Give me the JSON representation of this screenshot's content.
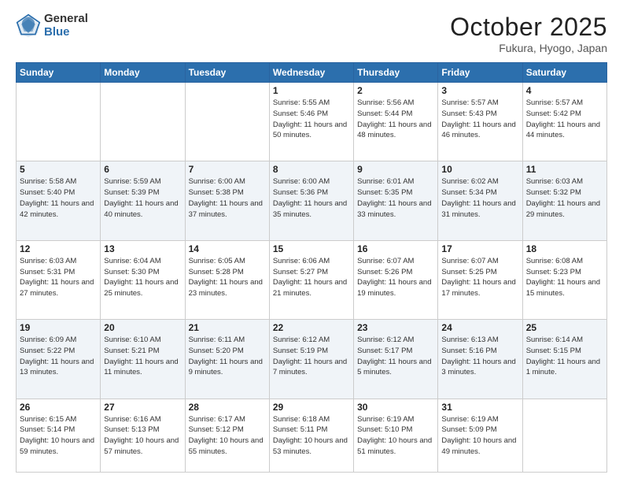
{
  "logo": {
    "general": "General",
    "blue": "Blue"
  },
  "header": {
    "month": "October 2025",
    "location": "Fukura, Hyogo, Japan"
  },
  "weekdays": [
    "Sunday",
    "Monday",
    "Tuesday",
    "Wednesday",
    "Thursday",
    "Friday",
    "Saturday"
  ],
  "weeks": [
    [
      {
        "day": "",
        "sunrise": "",
        "sunset": "",
        "daylight": ""
      },
      {
        "day": "",
        "sunrise": "",
        "sunset": "",
        "daylight": ""
      },
      {
        "day": "",
        "sunrise": "",
        "sunset": "",
        "daylight": ""
      },
      {
        "day": "1",
        "sunrise": "Sunrise: 5:55 AM",
        "sunset": "Sunset: 5:46 PM",
        "daylight": "Daylight: 11 hours and 50 minutes."
      },
      {
        "day": "2",
        "sunrise": "Sunrise: 5:56 AM",
        "sunset": "Sunset: 5:44 PM",
        "daylight": "Daylight: 11 hours and 48 minutes."
      },
      {
        "day": "3",
        "sunrise": "Sunrise: 5:57 AM",
        "sunset": "Sunset: 5:43 PM",
        "daylight": "Daylight: 11 hours and 46 minutes."
      },
      {
        "day": "4",
        "sunrise": "Sunrise: 5:57 AM",
        "sunset": "Sunset: 5:42 PM",
        "daylight": "Daylight: 11 hours and 44 minutes."
      }
    ],
    [
      {
        "day": "5",
        "sunrise": "Sunrise: 5:58 AM",
        "sunset": "Sunset: 5:40 PM",
        "daylight": "Daylight: 11 hours and 42 minutes."
      },
      {
        "day": "6",
        "sunrise": "Sunrise: 5:59 AM",
        "sunset": "Sunset: 5:39 PM",
        "daylight": "Daylight: 11 hours and 40 minutes."
      },
      {
        "day": "7",
        "sunrise": "Sunrise: 6:00 AM",
        "sunset": "Sunset: 5:38 PM",
        "daylight": "Daylight: 11 hours and 37 minutes."
      },
      {
        "day": "8",
        "sunrise": "Sunrise: 6:00 AM",
        "sunset": "Sunset: 5:36 PM",
        "daylight": "Daylight: 11 hours and 35 minutes."
      },
      {
        "day": "9",
        "sunrise": "Sunrise: 6:01 AM",
        "sunset": "Sunset: 5:35 PM",
        "daylight": "Daylight: 11 hours and 33 minutes."
      },
      {
        "day": "10",
        "sunrise": "Sunrise: 6:02 AM",
        "sunset": "Sunset: 5:34 PM",
        "daylight": "Daylight: 11 hours and 31 minutes."
      },
      {
        "day": "11",
        "sunrise": "Sunrise: 6:03 AM",
        "sunset": "Sunset: 5:32 PM",
        "daylight": "Daylight: 11 hours and 29 minutes."
      }
    ],
    [
      {
        "day": "12",
        "sunrise": "Sunrise: 6:03 AM",
        "sunset": "Sunset: 5:31 PM",
        "daylight": "Daylight: 11 hours and 27 minutes."
      },
      {
        "day": "13",
        "sunrise": "Sunrise: 6:04 AM",
        "sunset": "Sunset: 5:30 PM",
        "daylight": "Daylight: 11 hours and 25 minutes."
      },
      {
        "day": "14",
        "sunrise": "Sunrise: 6:05 AM",
        "sunset": "Sunset: 5:28 PM",
        "daylight": "Daylight: 11 hours and 23 minutes."
      },
      {
        "day": "15",
        "sunrise": "Sunrise: 6:06 AM",
        "sunset": "Sunset: 5:27 PM",
        "daylight": "Daylight: 11 hours and 21 minutes."
      },
      {
        "day": "16",
        "sunrise": "Sunrise: 6:07 AM",
        "sunset": "Sunset: 5:26 PM",
        "daylight": "Daylight: 11 hours and 19 minutes."
      },
      {
        "day": "17",
        "sunrise": "Sunrise: 6:07 AM",
        "sunset": "Sunset: 5:25 PM",
        "daylight": "Daylight: 11 hours and 17 minutes."
      },
      {
        "day": "18",
        "sunrise": "Sunrise: 6:08 AM",
        "sunset": "Sunset: 5:23 PM",
        "daylight": "Daylight: 11 hours and 15 minutes."
      }
    ],
    [
      {
        "day": "19",
        "sunrise": "Sunrise: 6:09 AM",
        "sunset": "Sunset: 5:22 PM",
        "daylight": "Daylight: 11 hours and 13 minutes."
      },
      {
        "day": "20",
        "sunrise": "Sunrise: 6:10 AM",
        "sunset": "Sunset: 5:21 PM",
        "daylight": "Daylight: 11 hours and 11 minutes."
      },
      {
        "day": "21",
        "sunrise": "Sunrise: 6:11 AM",
        "sunset": "Sunset: 5:20 PM",
        "daylight": "Daylight: 11 hours and 9 minutes."
      },
      {
        "day": "22",
        "sunrise": "Sunrise: 6:12 AM",
        "sunset": "Sunset: 5:19 PM",
        "daylight": "Daylight: 11 hours and 7 minutes."
      },
      {
        "day": "23",
        "sunrise": "Sunrise: 6:12 AM",
        "sunset": "Sunset: 5:17 PM",
        "daylight": "Daylight: 11 hours and 5 minutes."
      },
      {
        "day": "24",
        "sunrise": "Sunrise: 6:13 AM",
        "sunset": "Sunset: 5:16 PM",
        "daylight": "Daylight: 11 hours and 3 minutes."
      },
      {
        "day": "25",
        "sunrise": "Sunrise: 6:14 AM",
        "sunset": "Sunset: 5:15 PM",
        "daylight": "Daylight: 11 hours and 1 minute."
      }
    ],
    [
      {
        "day": "26",
        "sunrise": "Sunrise: 6:15 AM",
        "sunset": "Sunset: 5:14 PM",
        "daylight": "Daylight: 10 hours and 59 minutes."
      },
      {
        "day": "27",
        "sunrise": "Sunrise: 6:16 AM",
        "sunset": "Sunset: 5:13 PM",
        "daylight": "Daylight: 10 hours and 57 minutes."
      },
      {
        "day": "28",
        "sunrise": "Sunrise: 6:17 AM",
        "sunset": "Sunset: 5:12 PM",
        "daylight": "Daylight: 10 hours and 55 minutes."
      },
      {
        "day": "29",
        "sunrise": "Sunrise: 6:18 AM",
        "sunset": "Sunset: 5:11 PM",
        "daylight": "Daylight: 10 hours and 53 minutes."
      },
      {
        "day": "30",
        "sunrise": "Sunrise: 6:19 AM",
        "sunset": "Sunset: 5:10 PM",
        "daylight": "Daylight: 10 hours and 51 minutes."
      },
      {
        "day": "31",
        "sunrise": "Sunrise: 6:19 AM",
        "sunset": "Sunset: 5:09 PM",
        "daylight": "Daylight: 10 hours and 49 minutes."
      },
      {
        "day": "",
        "sunrise": "",
        "sunset": "",
        "daylight": ""
      }
    ]
  ]
}
